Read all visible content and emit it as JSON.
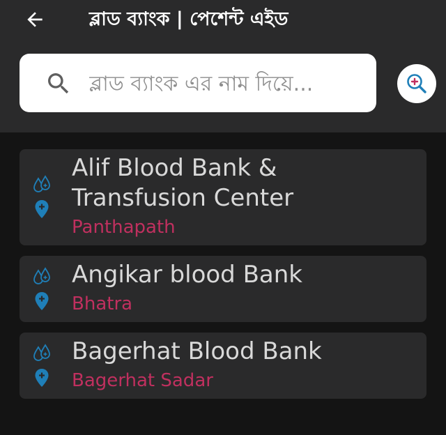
{
  "header": {
    "title": "ব্লাড ব্যাংক | পেশেন্ট এইড"
  },
  "search": {
    "placeholder": "ব্লাড ব্যাংক এর নাম দিয়ে..."
  },
  "colors": {
    "header_bg": "#2a2a2b",
    "page_bg": "#141414",
    "location_text": "#c0305f",
    "icon_blue": "#1f7fb8"
  },
  "icons": {
    "back": "arrow-left-icon",
    "search": "search-icon",
    "fab": "search-plus-icon",
    "blood": "blood-drop-icon",
    "location": "location-pin-icon"
  },
  "blood_banks": [
    {
      "name": "Alif Blood Bank & Transfusion Center",
      "location": "Panthapath"
    },
    {
      "name": "Angikar blood Bank",
      "location": "Bhatra"
    },
    {
      "name": "Bagerhat Blood Bank",
      "location": "Bagerhat Sadar"
    }
  ]
}
